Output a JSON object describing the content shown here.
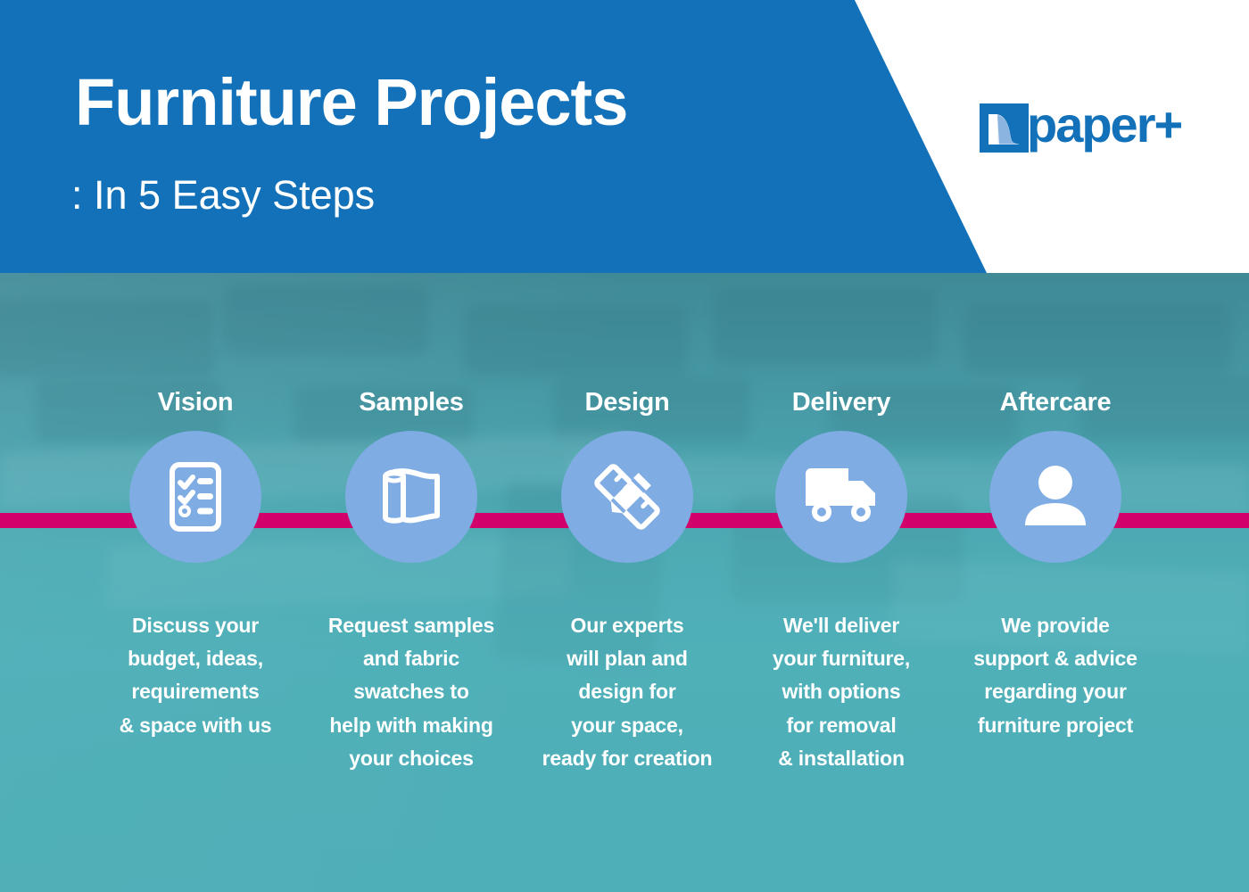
{
  "header": {
    "title": "Furniture Projects",
    "subtitle": ": In 5 Easy Steps",
    "background_color": "#1271B8"
  },
  "logo": {
    "text": "paper+",
    "mark_name": "paper-plus-square-mark",
    "color": "#1271B8"
  },
  "connector": {
    "color": "#D1006B"
  },
  "theme": {
    "circle_color": "#7FACE3",
    "photo_tint": "#4FAFB8",
    "text_color": "#FFFFFF"
  },
  "steps": [
    {
      "label": "Vision",
      "icon": "checklist-clipboard-icon",
      "description": "Discuss your\nbudget, ideas,\nrequirements\n& space with us"
    },
    {
      "label": "Samples",
      "icon": "fabric-roll-icon",
      "description": "Request samples\nand fabric\nswatches to\nhelp with making\nyour choices"
    },
    {
      "label": "Design",
      "icon": "pencil-ruler-icon",
      "description": "Our experts\nwill plan and\ndesign for\nyour space,\nready for creation"
    },
    {
      "label": "Delivery",
      "icon": "delivery-truck-icon",
      "description": "We'll deliver\nyour furniture,\nwith options\nfor removal\n& installation"
    },
    {
      "label": "Aftercare",
      "icon": "person-support-icon",
      "description": "We provide\nsupport & advice\nregarding your\nfurniture project"
    }
  ]
}
